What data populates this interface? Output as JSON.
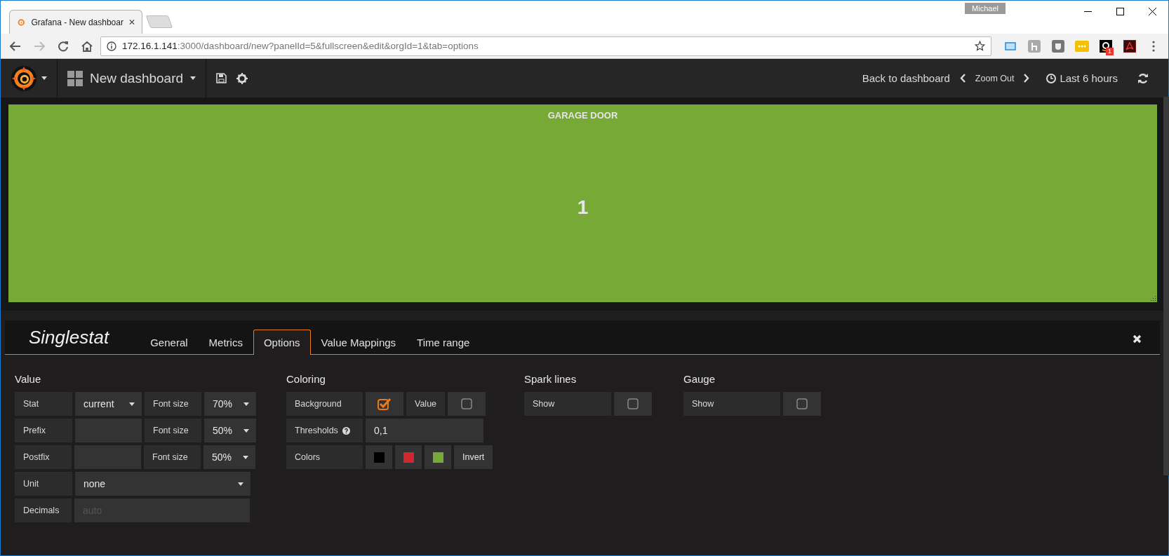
{
  "browser": {
    "tab_title": "Grafana - New dashboar",
    "profile": "Michael",
    "url_host": "172.16.1.141",
    "url_rest": ":3000/dashboard/new?panelId=5&fullscreen&edit&orgId=1&tab=options",
    "extension_badge": "1"
  },
  "navbar": {
    "dashboard_title": "New dashboard",
    "back_link": "Back to dashboard",
    "zoom": "Zoom Out",
    "time_range": "Last 6 hours"
  },
  "panel": {
    "title": "GARAGE DOOR",
    "value": "1"
  },
  "editor": {
    "title": "Singlestat",
    "tabs": [
      {
        "label": "General",
        "selected": false
      },
      {
        "label": "Metrics",
        "selected": false
      },
      {
        "label": "Options",
        "selected": true
      },
      {
        "label": "Value Mappings",
        "selected": false
      },
      {
        "label": "Time range",
        "selected": false
      }
    ],
    "value": {
      "heading": "Value",
      "rows": [
        {
          "items": [
            {
              "kind": "label",
              "text": "Stat"
            },
            {
              "kind": "select",
              "value": "current"
            },
            {
              "kind": "label",
              "text": "Font size"
            },
            {
              "kind": "select-small",
              "value": "70%"
            }
          ]
        },
        {
          "items": [
            {
              "kind": "label",
              "text": "Prefix"
            },
            {
              "kind": "input"
            },
            {
              "kind": "label",
              "text": "Font size"
            },
            {
              "kind": "select-small",
              "value": "50%"
            }
          ]
        },
        {
          "items": [
            {
              "kind": "label",
              "text": "Postfix"
            },
            {
              "kind": "input"
            },
            {
              "kind": "label",
              "text": "Font size"
            },
            {
              "kind": "select-small",
              "value": "50%"
            }
          ]
        },
        {
          "items": [
            {
              "kind": "label",
              "text": "Unit"
            },
            {
              "kind": "select-wide",
              "value": "none"
            }
          ]
        },
        {
          "items": [
            {
              "kind": "label",
              "text": "Decimals"
            },
            {
              "kind": "input-wide",
              "placeholder": "auto"
            }
          ]
        }
      ]
    },
    "coloring": {
      "heading": "Coloring",
      "background_label": "Background",
      "background_checked": true,
      "value_label": "Value",
      "value_checked": false,
      "thresholds_label": "Thresholds",
      "thresholds": "0,1",
      "colors_label": "Colors",
      "colors": [
        {
          "color": "#000000"
        },
        {
          "color": "#d0262e"
        },
        {
          "color": "#76a935"
        }
      ],
      "invert_label": "Invert"
    },
    "spark_lines": {
      "heading": "Spark lines",
      "label": "Show",
      "checked": false
    },
    "gauge": {
      "heading": "Gauge",
      "label": "Show",
      "checked": false
    }
  }
}
